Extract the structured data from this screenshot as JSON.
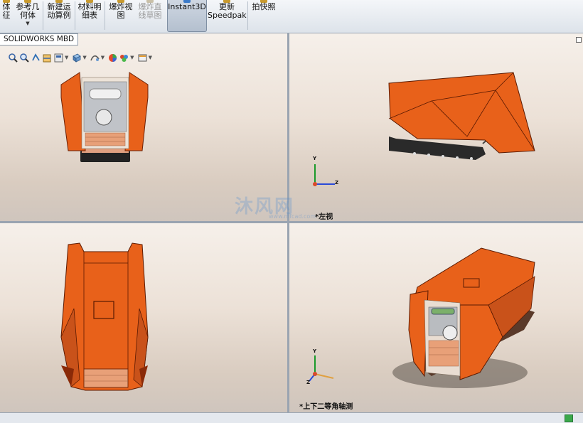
{
  "toolbar": {
    "feature_partial": "体\n征",
    "ref_geometry": "参考几\n何体",
    "new_motion": "新建运\n动算例",
    "bom": "材料明\n细表",
    "explode_view": "爆炸视\n图",
    "explode_line": "爆炸直\n线草图",
    "instant3d": "Instant3D",
    "update_speedpak": "更新\nSpeedpak",
    "snapshot": "拍快照"
  },
  "tabs": {
    "mbd": "SOLIDWORKS MBD"
  },
  "viewports": {
    "top_right_label": "*左视",
    "bottom_right_label": "*上下二等角轴测"
  },
  "triad": {
    "x": "X",
    "y": "Y",
    "z": "Z"
  },
  "watermark": {
    "text": "沐风网",
    "sub": "www.mfcad.com"
  },
  "colors": {
    "model_orange": "#e8611a",
    "model_dark": "#8a2a08",
    "active_button": "#b4c0cf"
  }
}
